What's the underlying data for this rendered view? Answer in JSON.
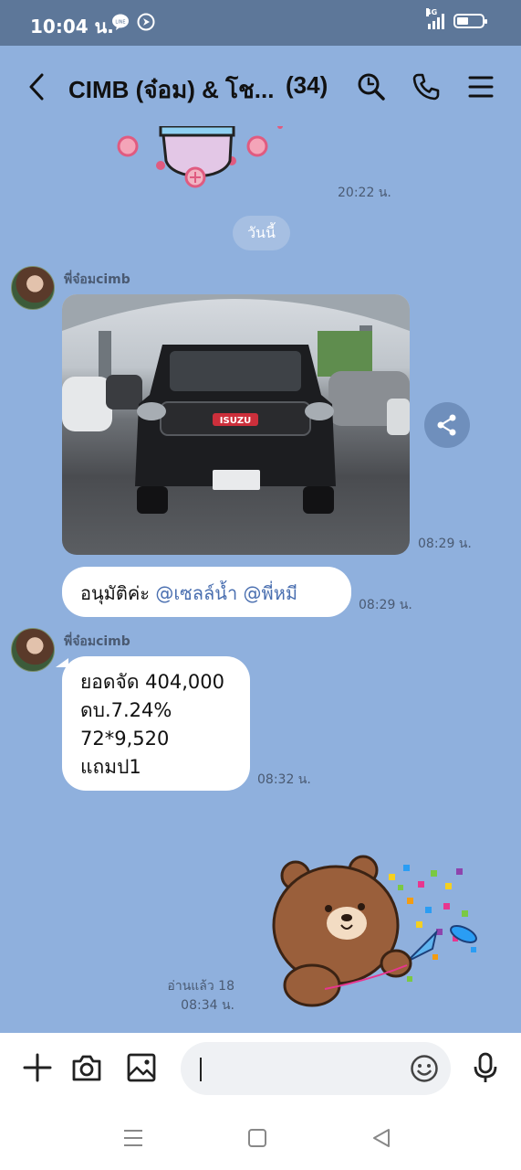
{
  "status_bar": {
    "time": "10:04 น.",
    "network": "4G"
  },
  "header": {
    "title": "CIMB (จ๋อม) & โช...",
    "member_count": "(34)"
  },
  "chat": {
    "sticker_time": "20:22 น.",
    "date_divider": "วันนี้",
    "messages": [
      {
        "sender": "พี่จ๋อมcimb",
        "kind": "image",
        "image_plate": "ISUZU",
        "time": "08:29 น."
      },
      {
        "kind": "text",
        "text": "อนุมัติค่ะ ",
        "mention_1": "@เซลล์น้ำ",
        "mention_2": " @พี่หมี",
        "time": "08:29 น."
      },
      {
        "sender": "พี่จ๋อมcimb",
        "kind": "text",
        "lines": [
          "ยอดจัด 404,000",
          "ดบ.7.24%",
          "72*9,520",
          "แถมป1"
        ],
        "time": "08:32 น."
      }
    ],
    "own_sticker": {
      "read_receipt": "อ่านแล้ว 18",
      "time": "08:34 น."
    }
  },
  "input_bar": {
    "placeholder": ""
  },
  "colors": {
    "chat_background": "#8fb0dd",
    "status_bar": "#5d7799",
    "mention": "#4a6fb0",
    "bubble": "#ffffff"
  },
  "icons": [
    "back-arrow-icon",
    "search-icon",
    "phone-icon",
    "menu-icon",
    "share-icon",
    "plus-icon",
    "camera-icon",
    "image-icon",
    "emoji-icon",
    "microphone-icon"
  ]
}
